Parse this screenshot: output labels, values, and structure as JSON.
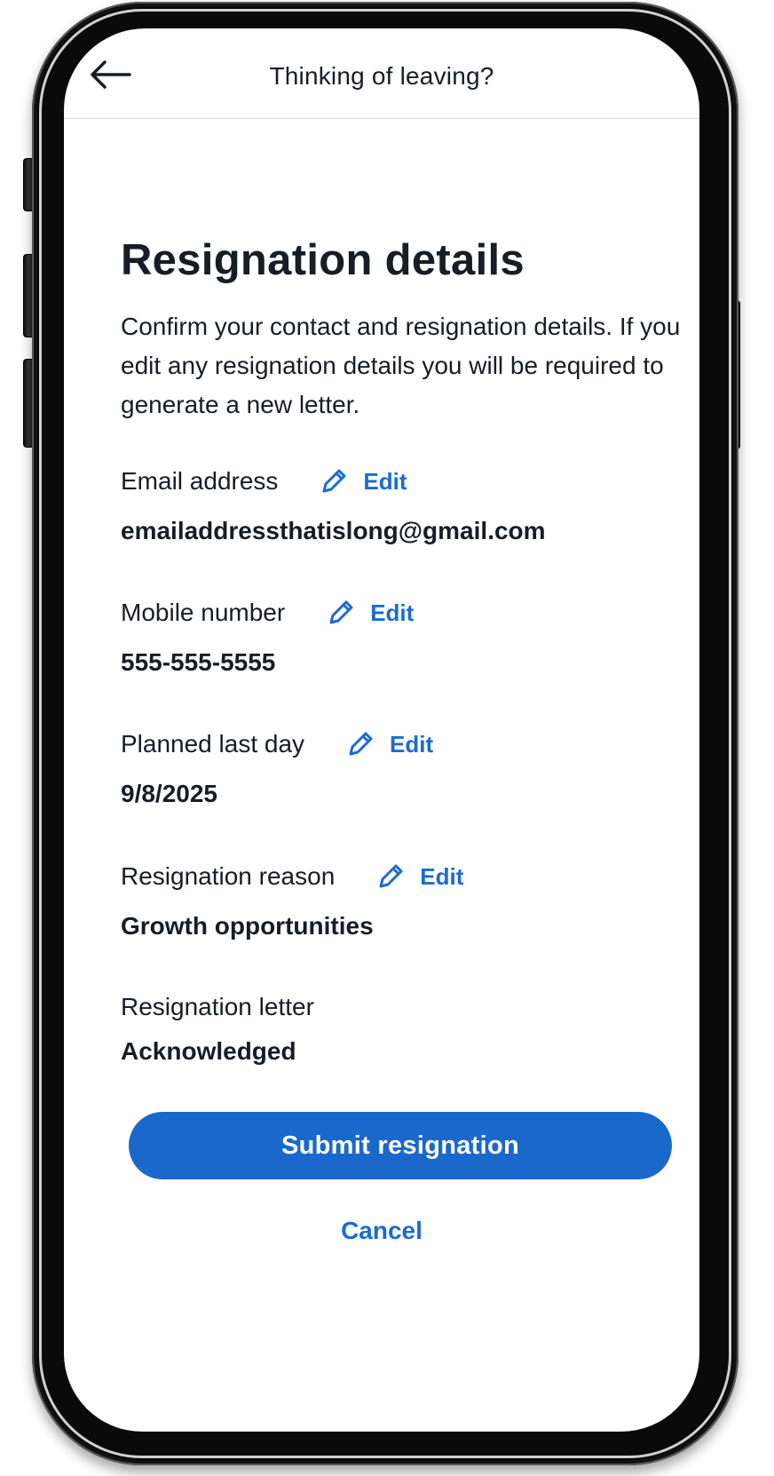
{
  "header": {
    "back_icon": "arrow-left-icon",
    "title": "Thinking of leaving?"
  },
  "main": {
    "title": "Resignation details",
    "description": "Confirm your contact and resignation details. If you edit any resignation details you will be required to generate a new letter.",
    "edit_icon": "pencil-icon",
    "fields": [
      {
        "label": "Email address",
        "edit_label": "Edit",
        "value": "emailaddressthatislong@gmail.com"
      },
      {
        "label": "Mobile number",
        "edit_label": "Edit",
        "value": "555-555-5555"
      },
      {
        "label": "Planned last day",
        "edit_label": "Edit",
        "value": "9/8/2025"
      },
      {
        "label": "Resignation reason",
        "edit_label": "Edit",
        "value": "Growth opportunities"
      },
      {
        "label": "Resignation letter",
        "value": "Acknowledged"
      }
    ],
    "submit_label": "Submit resignation",
    "cancel_label": "Cancel"
  },
  "colors": {
    "accent": "#1a68cc",
    "link": "#1a6bd4",
    "text": "#161d26",
    "divider": "#d9dbdf"
  }
}
